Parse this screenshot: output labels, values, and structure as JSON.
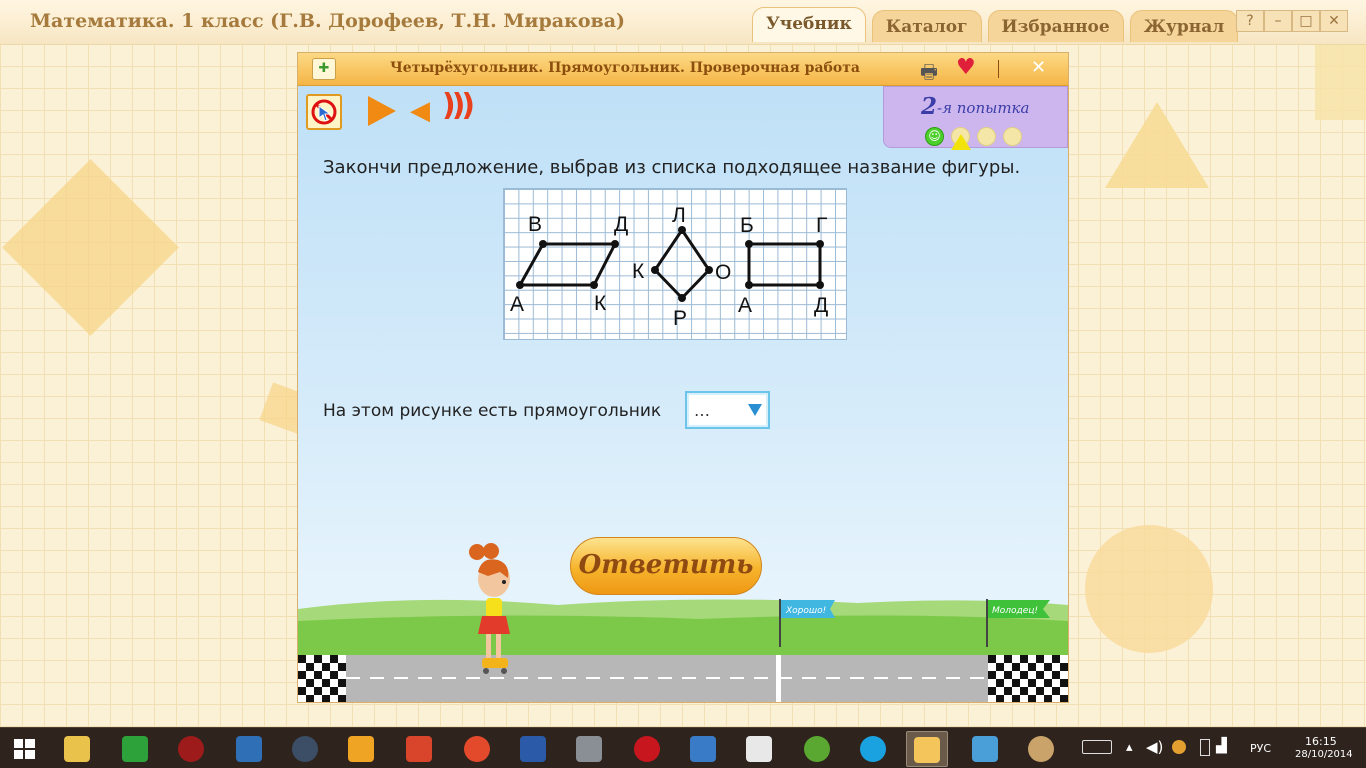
{
  "app": {
    "title": "Математика. 1 класс (Г.В. Дорофеев, Т.Н. Миракова)",
    "tabs": [
      "Учебник",
      "Каталог",
      "Избранное",
      "Журнал"
    ],
    "active_tab": "Учебник",
    "window_controls": [
      "?",
      "–",
      "□",
      "✕"
    ]
  },
  "lesson": {
    "title": "Четырёхугольник. Прямоугольник. Проверочная работа",
    "attempt_number": "2",
    "attempt_label": "-я попытка",
    "question": "Закончи предложение, выбрав из списка подходящее название фигуры.",
    "figure_labels": {
      "parallelogram": [
        "В",
        "Д",
        "А",
        "К"
      ],
      "rhombus": [
        "Л",
        "К",
        "О",
        "Р"
      ],
      "rectangle": [
        "Б",
        "Г",
        "А",
        "Д"
      ]
    },
    "answer_prefix": "На этом рисунке есть прямоугольник",
    "select_value": "…",
    "submit_label": "Ответить",
    "flag1": "Хорошо!",
    "flag2": "Молодец!"
  },
  "taskbar": {
    "language": "РУС",
    "time": "16:15",
    "date": "28/10/2014"
  },
  "colors": {
    "header_orange": "#f5b546",
    "title_brown": "#8c4e0d",
    "button_orange": "#f6b42c",
    "attempt_purple": "#cdb6ee"
  }
}
